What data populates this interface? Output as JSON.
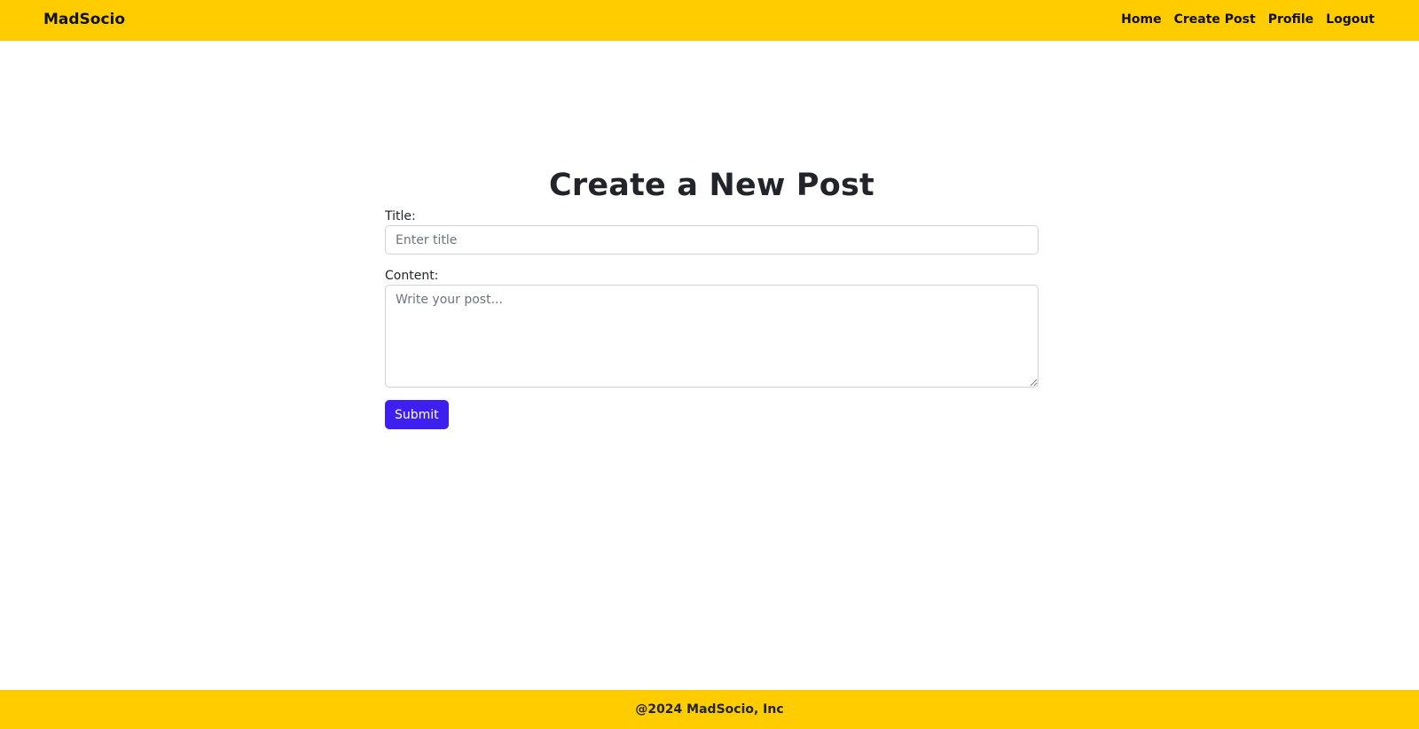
{
  "navbar": {
    "brand": "MadSocio",
    "links": [
      {
        "label": "Home"
      },
      {
        "label": "Create Post"
      },
      {
        "label": "Profile"
      },
      {
        "label": "Logout"
      }
    ]
  },
  "main": {
    "title": "Create a New Post",
    "form": {
      "title_label": "Title:",
      "title_value": "",
      "title_placeholder": "Enter title",
      "content_label": "Content:",
      "content_value": "",
      "content_placeholder": "Write your post...",
      "submit_label": "Submit"
    }
  },
  "footer": {
    "text": "@2024 MadSocio, Inc"
  },
  "colors": {
    "brand_yellow": "#ffcc00",
    "submit_button": "#3d1ff0",
    "text_dark": "#212529"
  }
}
